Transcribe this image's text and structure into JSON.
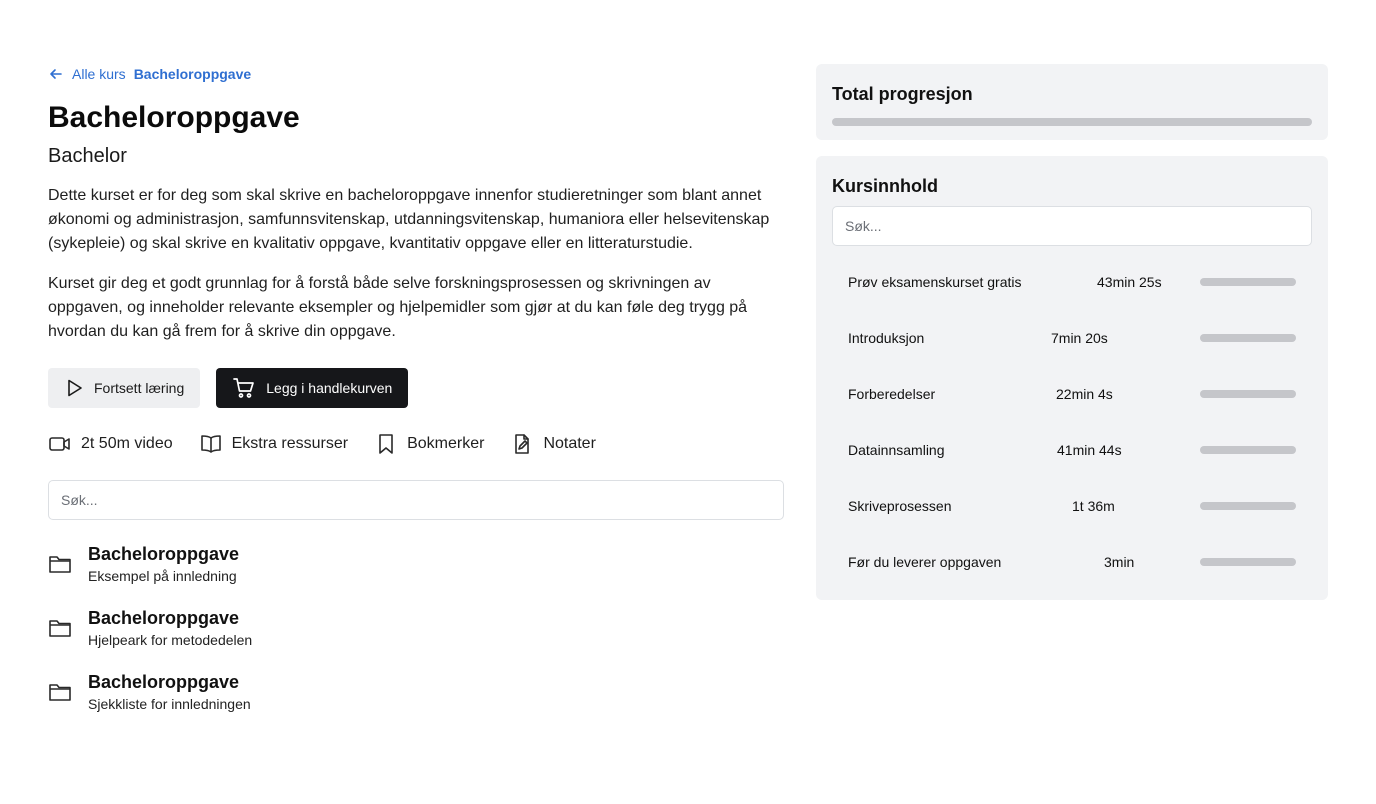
{
  "breadcrumb": {
    "back_label": "Alle kurs",
    "current": "Bacheloroppgave"
  },
  "course": {
    "title": "Bacheloroppgave",
    "level": "Bachelor",
    "description": [
      "Dette kurset er for deg som skal skrive en bacheloroppgave innenfor studieretninger som blant annet økonomi og administrasjon, samfunnsvitenskap, utdanningsvitenskap, humaniora eller helsevitenskap (sykepleie) og skal skrive en kvalitativ oppgave, kvantitativ oppgave eller en litteraturstudie.",
      "Kurset gir deg et godt grunnlag for å forstå både selve forskningsprosessen og skrivningen av oppgaven, og inneholder relevante eksempler og hjelpemidler som gjør at du kan føle deg trygg på hvordan du kan gå frem for å skrive din oppgave."
    ]
  },
  "actions": {
    "continue_label": "Fortsett læring",
    "cart_label": "Legg i handlekurven"
  },
  "meta": {
    "video_label": "2t 50m video",
    "resources_label": "Ekstra ressurser",
    "bookmarks_label": "Bokmerker",
    "notes_label": "Notater"
  },
  "search": {
    "placeholder": "Søk..."
  },
  "resources": [
    {
      "title": "Bacheloroppgave",
      "subtitle": "Eksempel på innledning",
      "icon": "folder-icon"
    },
    {
      "title": "Bacheloroppgave",
      "subtitle": "Hjelpeark for metodedelen",
      "icon": "folder-icon"
    },
    {
      "title": "Bacheloroppgave",
      "subtitle": "Sjekkliste for innledningen",
      "icon": "folder-icon"
    }
  ],
  "progress": {
    "title": "Total progresjon",
    "value": 0
  },
  "content": {
    "title": "Kursinnhold",
    "search_placeholder": "Søk...",
    "modules": [
      {
        "name": "Prøv eksamenskurset gratis",
        "duration": "43min 25s",
        "progress": 0
      },
      {
        "name": "Introduksjon",
        "duration": "7min 20s",
        "progress": 0
      },
      {
        "name": "Forberedelser",
        "duration": "22min 4s",
        "progress": 0
      },
      {
        "name": "Datainnsamling",
        "duration": "41min 44s",
        "progress": 0
      },
      {
        "name": "Skriveprosessen",
        "duration": "1t 36m",
        "progress": 0
      },
      {
        "name": "Før du leverer oppgaven",
        "duration": "3min",
        "progress": 0
      }
    ]
  },
  "colors": {
    "accent": "#2f6fd1",
    "primary_button": "#16171a",
    "card_bg": "#f2f3f5",
    "track": "#c5c6ca"
  }
}
